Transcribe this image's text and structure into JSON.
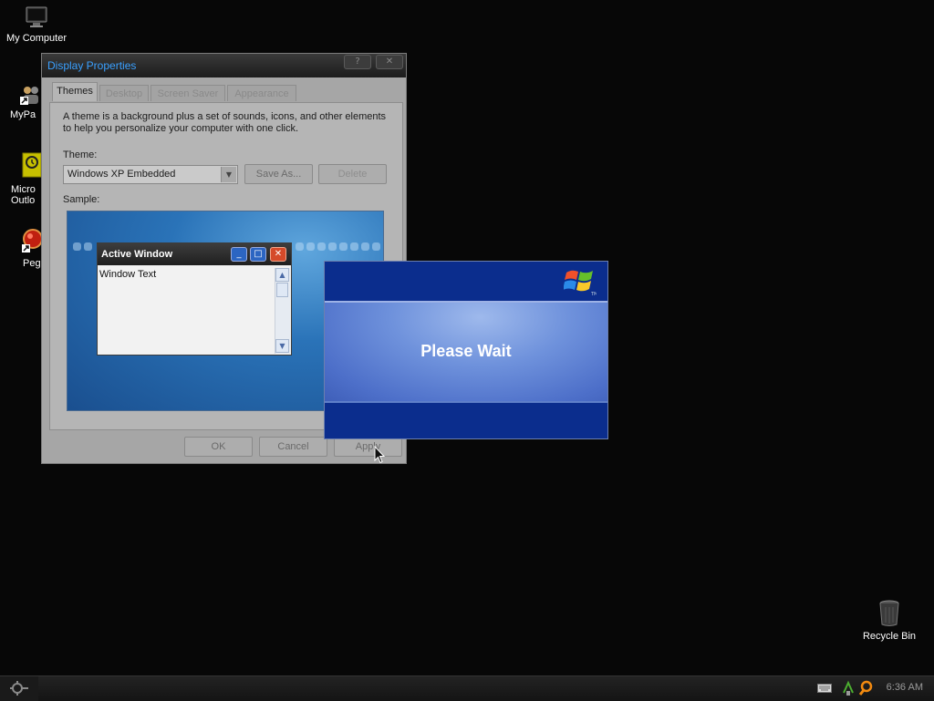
{
  "desktop": {
    "icons": [
      {
        "label": "My Computer"
      },
      {
        "label": "MyPa"
      },
      {
        "label": "Micro\nOutlo"
      },
      {
        "label": "Peg"
      },
      {
        "label": "Recycle Bin"
      }
    ]
  },
  "display_properties": {
    "title": "Display Properties",
    "help_button": "?",
    "close_button": "✕",
    "tabs": [
      {
        "label": "Themes",
        "active": true
      },
      {
        "label": "Desktop"
      },
      {
        "label": "Screen Saver"
      },
      {
        "label": "Appearance"
      }
    ],
    "description": "A theme is a background plus a set of sounds, icons, and other elements to help you personalize your computer with one click.",
    "theme_label": "Theme:",
    "theme_value": "Windows XP Embedded",
    "save_as": "Save As...",
    "delete": "Delete",
    "sample_label": "Sample:",
    "sample": {
      "active_window_title": "Active Window",
      "window_text": "Window Text"
    },
    "ok": "OK",
    "cancel": "Cancel",
    "apply": "Apply"
  },
  "please_wait": {
    "message": "Please Wait"
  },
  "taskbar": {
    "clock": "6:36 AM"
  },
  "colors": {
    "desktop_bg": "#070707",
    "title_text": "#3aa0ff",
    "please_wait_band": "#6f92dc",
    "please_wait_bg": "#0b2d8d"
  }
}
